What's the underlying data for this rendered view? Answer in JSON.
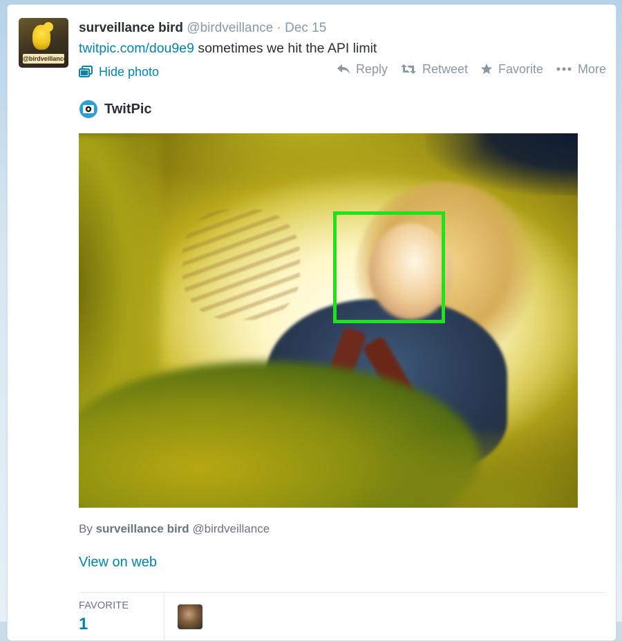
{
  "tweet": {
    "fullname": "surveillance bird",
    "handle": "@birdveillance",
    "separator": "·",
    "date": "Dec 15",
    "link_text": "twitpic.com/dou9e9",
    "text": " sometimes we hit the API limit",
    "avatar_sign": "@birdveillance"
  },
  "photo_toggle": {
    "label": "Hide photo",
    "icon": "photo-stack-icon"
  },
  "actions": [
    {
      "label": "Reply",
      "icon": "reply-icon"
    },
    {
      "label": "Retweet",
      "icon": "retweet-icon"
    },
    {
      "label": "Favorite",
      "icon": "star-icon"
    },
    {
      "label": "More",
      "icon": "more-dots-icon"
    }
  ],
  "card": {
    "provider": "TwitPic",
    "provider_icon": "twitpic-logo-icon",
    "byline_prefix": "By ",
    "byline_name": "surveillance bird",
    "byline_handle": " @birdveillance",
    "view_on_web": "View on web"
  },
  "stats": {
    "favorite_label": "FAVORITE",
    "favorite_count": "1"
  },
  "colors": {
    "link": "#0084b4",
    "text": "#292f33",
    "muted": "#8899a6",
    "facebox": "#1ee31b"
  }
}
